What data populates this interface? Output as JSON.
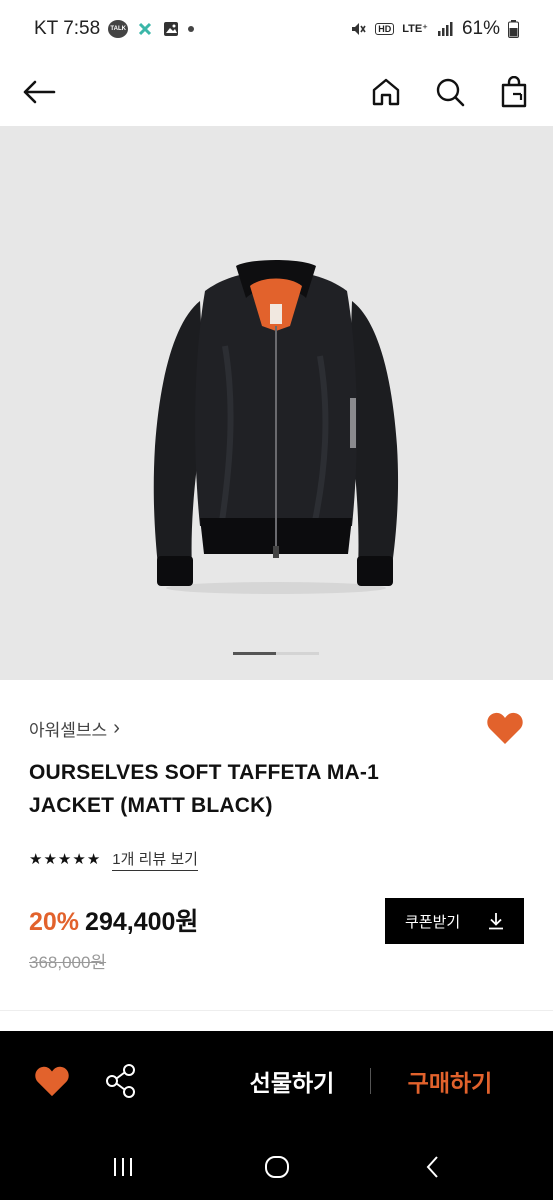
{
  "status_bar": {
    "carrier_time": "KT 7:58",
    "talk_badge": "TALK",
    "hd": "HD",
    "lte": "LTE⁺",
    "battery": "61%"
  },
  "top_nav": {
    "icons": [
      "back-arrow-icon",
      "home-icon",
      "search-icon",
      "shopping-bag-icon"
    ]
  },
  "gallery": {
    "current_index": 1,
    "total": 2
  },
  "product": {
    "brand": "아워셀브스",
    "brand_chevron": "›",
    "title": "OURSELVES SOFT TAFFETA MA-1 JACKET (MATT BLACK)",
    "rating_stars": 5,
    "review_link": "1개 리뷰 보기",
    "discount": "20%",
    "price": "294,400원",
    "original_price": "368,000원",
    "coupon_label": "쿠폰받기",
    "wished": true
  },
  "action_bar": {
    "gift_label": "선물하기",
    "buy_label": "구매하기"
  },
  "colors": {
    "accent": "#e2622c",
    "black": "#000000",
    "image_bg": "#e7e7e7"
  }
}
